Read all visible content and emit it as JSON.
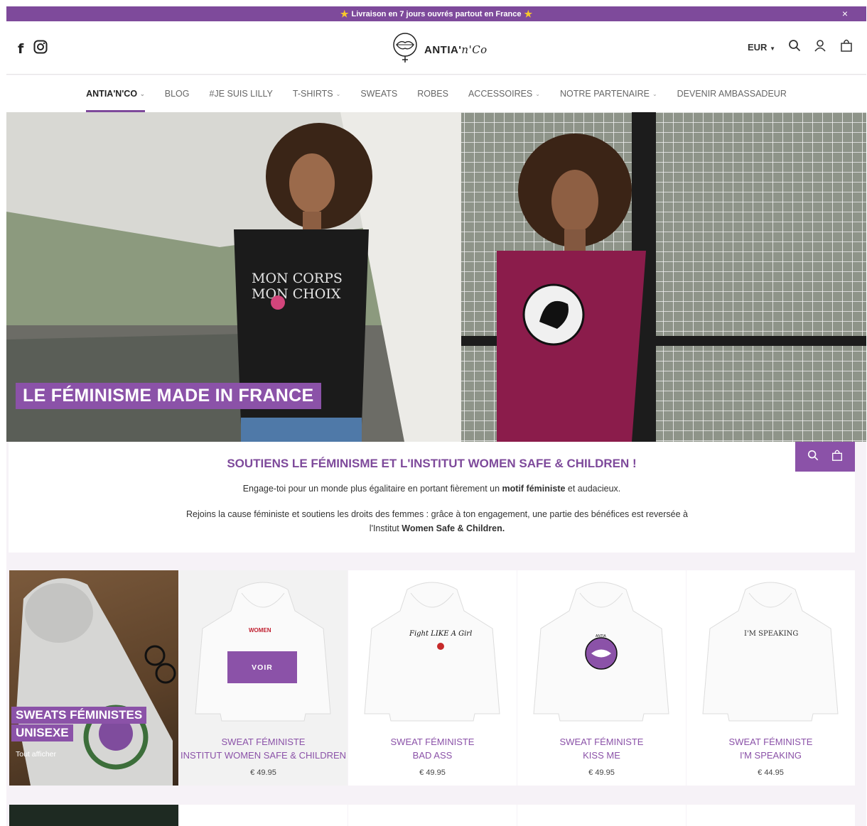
{
  "announcement": {
    "text": "Livraison en 7 jours ouvrés partout en France",
    "close": "×"
  },
  "header": {
    "brand": "ANTIA'",
    "brand_script": "n'Co",
    "currency": "EUR"
  },
  "nav": [
    {
      "label": "ANTIA'N'CO"
    },
    {
      "label": "BLOG"
    },
    {
      "label": "#JE SUIS LILLY"
    },
    {
      "label": "T-SHIRTS"
    },
    {
      "label": "SWEATS"
    },
    {
      "label": "ROBES"
    },
    {
      "label": "ACCESSOIRES"
    },
    {
      "label": "NOTRE PARTENAIRE"
    },
    {
      "label": "DEVENIR AMBASSADEUR"
    }
  ],
  "hero": {
    "title": "LE FÉMINISME MADE IN FRANCE",
    "shirt_text_1": "MON CORPS",
    "shirt_text_2": "MON CHOIX"
  },
  "intro": {
    "heading": "SOUTIENS LE FÉMINISME ET L'INSTITUT WOMEN SAFE & CHILDREN !",
    "p1_a": "Engage-toi pour un monde plus égalitaire en portant fièrement un ",
    "p1_b": "motif féministe",
    "p1_c": " et audacieux.",
    "p2_a": "Rejoins la cause féministe et soutiens les droits des femmes : grâce à ton engagement, une partie des bénéfices est reversée à l'Institut ",
    "p2_b": "Women Safe & Children."
  },
  "collection": {
    "title_1": "SWEATS FÉMINISTES",
    "title_2": "UNISEXE",
    "view_all": "Tout afficher"
  },
  "products": [
    {
      "line1": "SWEAT FÉMINISTE",
      "line2": "INSTITUT WOMEN SAFE & CHILDREN",
      "price": "€ 49.95",
      "print": "WOMEN"
    },
    {
      "line1": "SWEAT FÉMINISTE",
      "line2": "BAD ASS",
      "price": "€ 49.95",
      "print": "Fight LIKE A Girl"
    },
    {
      "line1": "SWEAT FÉMINISTE",
      "line2": "KISS ME",
      "price": "€ 49.95",
      "print": "ANTIA"
    },
    {
      "line1": "SWEAT FÉMINISTE",
      "line2": "I'M SPEAKING",
      "price": "€ 44.95",
      "print": "I'M SPEAKING"
    }
  ],
  "quick_view": "VOIR",
  "colors": {
    "accent": "#8b52a8",
    "announce": "#7e4a9b",
    "heading": "#7e4a9b"
  }
}
